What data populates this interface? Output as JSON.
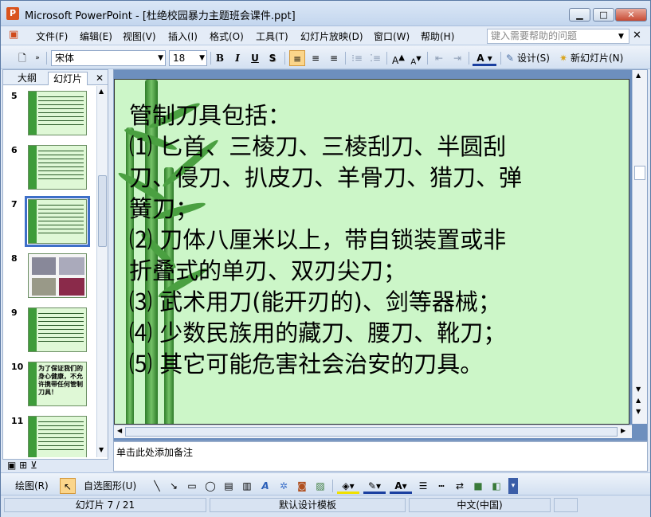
{
  "window": {
    "title": "Microsoft PowerPoint - [杜绝校园暴力主题班会课件.ppt]",
    "minimize": "▁",
    "maximize": "□",
    "close": "✕"
  },
  "menu": {
    "items": [
      "文件(F)",
      "编辑(E)",
      "视图(V)",
      "插入(I)",
      "格式(O)",
      "工具(T)",
      "幻灯片放映(D)",
      "窗口(W)",
      "帮助(H)"
    ],
    "help_placeholder": "键入需要帮助的问题"
  },
  "toolbar": {
    "font": "宋体",
    "size": "18",
    "bold": "B",
    "italic": "I",
    "underline": "U",
    "shadow": "S",
    "design": "设计(S)",
    "new_slide": "新幻灯片(N)"
  },
  "left_panel": {
    "tabs": [
      "大纲",
      "幻灯片"
    ],
    "close": "✕",
    "thumbnails": [
      {
        "number": "5"
      },
      {
        "number": "6"
      },
      {
        "number": "7",
        "selected": true
      },
      {
        "number": "8"
      },
      {
        "number": "9"
      },
      {
        "number": "10",
        "text": "为了保证我们的身心健康，不允许携带任何管制刀具！"
      },
      {
        "number": "11"
      }
    ]
  },
  "slide": {
    "lines": [
      "管制刀具包括：",
      "⑴ 匕首、三棱刀、三棱刮刀、半圆刮",
      "刀、侵刀、扒皮刀、羊骨刀、猎刀、弹",
      "簧刀；",
      "⑵ 刀体八厘米以上，带自锁装置或非",
      "折叠式的单刃、双刃尖刀；",
      "⑶ 武术用刀(能开刃的)、剑等器械；",
      "⑷ 少数民族用的藏刀、腰刀、靴刀；",
      "⑸ 其它可能危害社会治安的刀具。"
    ]
  },
  "notes": {
    "placeholder": "单击此处添加备注"
  },
  "drawbar": {
    "draw": "绘图(R)",
    "autoshapes": "自选图形(U)"
  },
  "status": {
    "slide_count": "幻灯片 7 / 21",
    "template": "默认设计模板",
    "language": "中文(中国)"
  }
}
